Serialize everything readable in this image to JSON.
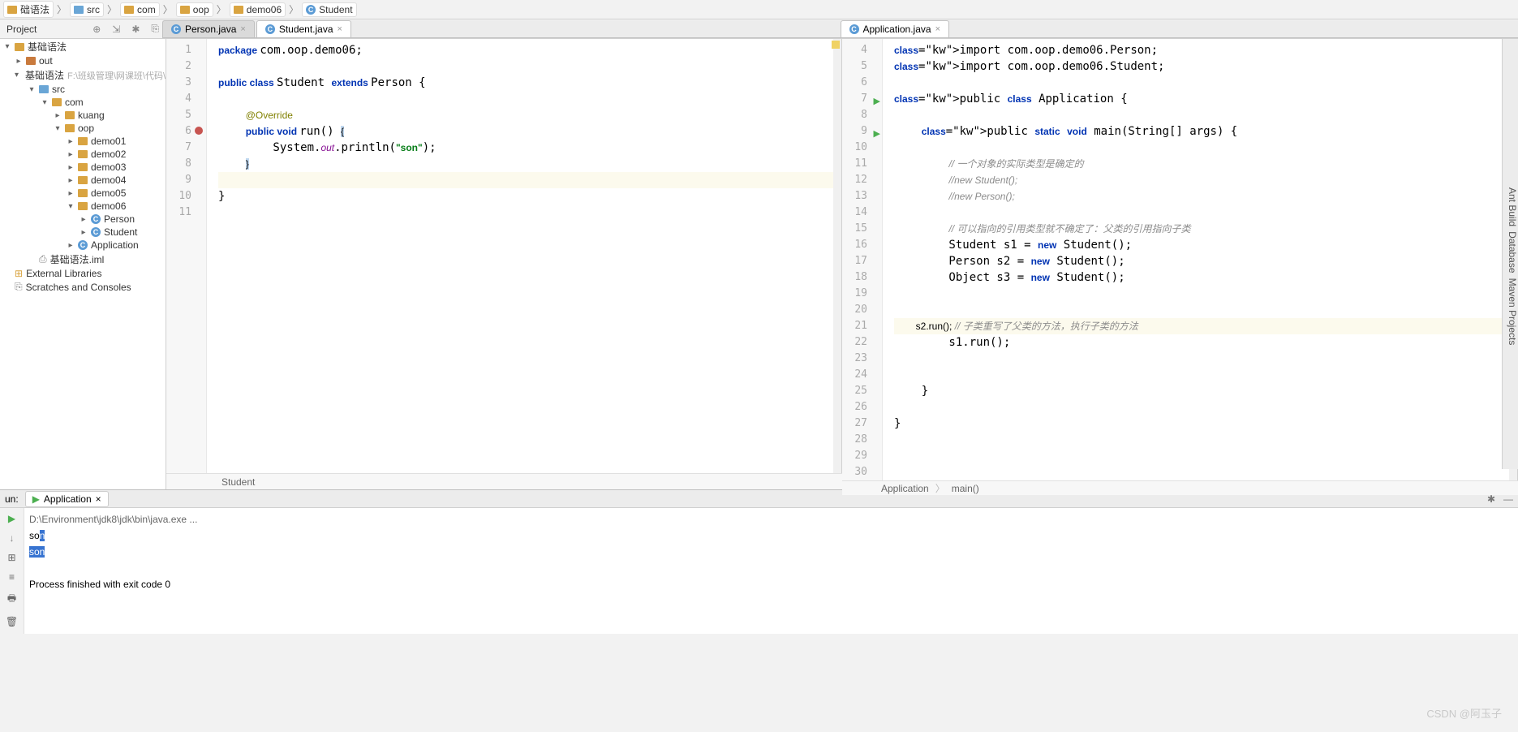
{
  "breadcrumb": [
    "础语法",
    "src",
    "com",
    "oop",
    "demo06",
    "Student"
  ],
  "project_label": "Project",
  "tree": {
    "root": "基础语法",
    "out": "out",
    "module": "基础语法",
    "module_path": "F:\\班级管理\\网课班\\代码\\Ja",
    "src": "src",
    "com": "com",
    "kuang": "kuang",
    "oop": "oop",
    "demos": [
      "demo01",
      "demo02",
      "demo03",
      "demo04",
      "demo05",
      "demo06"
    ],
    "classes": [
      "Person",
      "Student",
      "Application"
    ],
    "iml": "基础语法.iml",
    "ext": "External Libraries",
    "scratch": "Scratches and Consoles"
  },
  "tabs_left": [
    {
      "label": "Person.java",
      "active": false
    },
    {
      "label": "Student.java",
      "active": true
    }
  ],
  "tabs_right": [
    {
      "label": "Application.java",
      "active": true
    }
  ],
  "editor_left": {
    "lines": [
      "1",
      "2",
      "3",
      "4",
      "5",
      "6",
      "7",
      "8",
      "9",
      "10",
      "11"
    ],
    "code": [
      {
        "t": "package ",
        "c": "kw"
      },
      {
        "t": "com.oop.demo06;\n\n"
      },
      {
        "t": "public class ",
        "c": "kw"
      },
      {
        "t": "Student "
      },
      {
        "t": "extends ",
        "c": "kw"
      },
      {
        "t": "Person {\n\n"
      },
      {
        "t": "    "
      },
      {
        "t": "@Override",
        "c": "ann"
      },
      {
        "t": "\n"
      },
      {
        "t": "    "
      },
      {
        "t": "public void ",
        "c": "kw"
      },
      {
        "t": "run() "
      },
      {
        "t": "{",
        "c": "brace"
      },
      {
        "t": "\n"
      },
      {
        "t": "        System."
      },
      {
        "t": "out",
        "c": "field"
      },
      {
        "t": ".println("
      },
      {
        "t": "\"son\"",
        "c": "str"
      },
      {
        "t": ");\n"
      },
      {
        "t": "    "
      },
      {
        "t": "}",
        "c": "brace"
      },
      {
        "t": "\n"
      },
      {
        "t": "    ",
        "hl": true
      },
      {
        "t": "\n"
      },
      {
        "t": "}\n"
      }
    ],
    "status": "Student"
  },
  "editor_right": {
    "lines": [
      "4",
      "5",
      "6",
      "7",
      "8",
      "9",
      "10",
      "11",
      "12",
      "13",
      "14",
      "15",
      "16",
      "17",
      "18",
      "19",
      "20",
      "21",
      "22",
      "23",
      "24",
      "25",
      "26",
      "27",
      "28",
      "29",
      "30"
    ],
    "run_markers": {
      "7": true,
      "9": true
    },
    "code_str": "import com.oop.demo06.Person;\nimport com.oop.demo06.Student;\n\npublic class Application {\n\n    public static void main(String[] args) {\n\n        // 一个对象的实际类型是确定的\n        //new Student();\n        //new Person();\n\n        // 可以指向的引用类型就不确定了：父类的引用指向子类\n        Student s1 = new Student();\n        Person s2 = new Student();\n        Object s3 = new Student();\n\n\n        s2.run(); // 子类重写了父类的方法，执行子类的方法\n        s1.run();\n\n\n    }\n\n}\n\n\n",
    "status_l": "Application",
    "status_r": "main()"
  },
  "run": {
    "label": "un:",
    "tab": "Application",
    "cmd": "D:\\Environment\\jdk8\\jdk\\bin\\java.exe ...",
    "out1": "son",
    "out2": "son",
    "exit": "Process finished with exit code 0"
  },
  "right_tools": [
    "Ant Build",
    "Database",
    "Maven Projects"
  ],
  "watermark": "CSDN @阿玉子"
}
